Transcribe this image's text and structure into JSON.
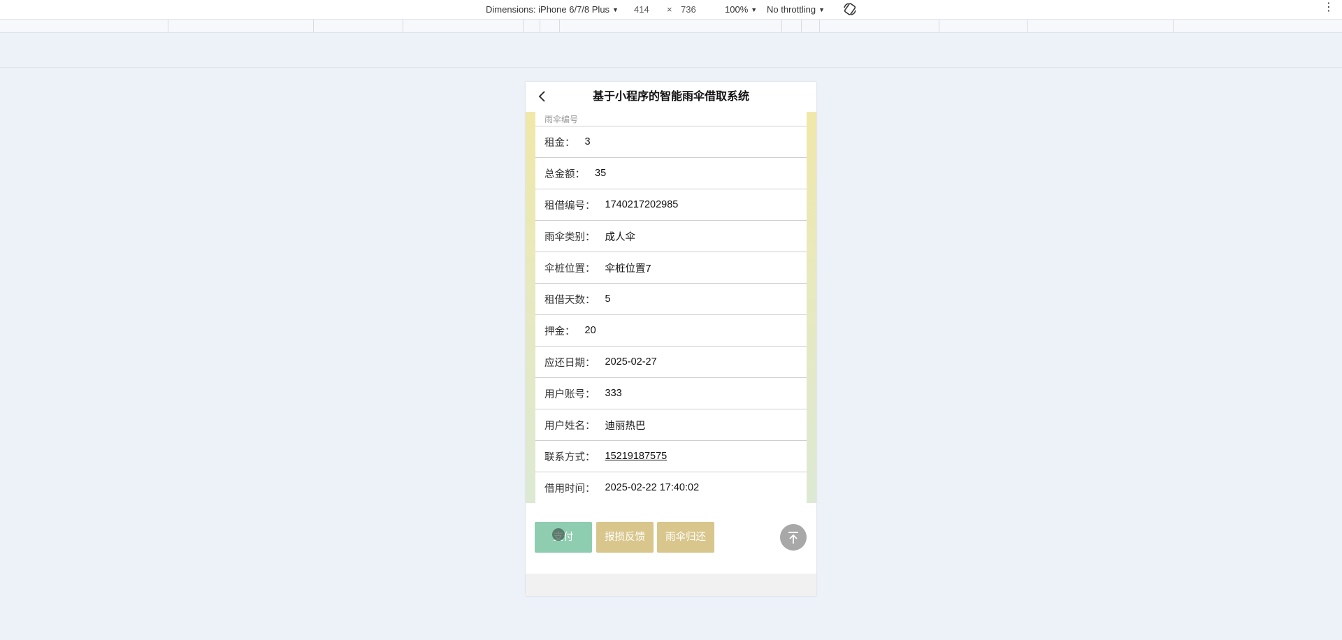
{
  "devtools": {
    "dimensions_label": "Dimensions: iPhone 6/7/8 Plus",
    "width": "414",
    "times": "×",
    "height": "736",
    "zoom": "100%",
    "throttling": "No throttling",
    "rotate_icon": "rotate-icon",
    "more_icon": "kebab-menu-icon"
  },
  "app": {
    "title": "基于小程序的智能雨伞借取系统",
    "back_icon": "back-arrow-icon"
  },
  "details": {
    "partial_label": "雨伞编号",
    "rows": [
      {
        "label": "租金：",
        "value": "3"
      },
      {
        "label": "总金额：",
        "value": "35"
      },
      {
        "label": "租借编号：",
        "value": "1740217202985"
      },
      {
        "label": "雨伞类别：",
        "value": "成人伞"
      },
      {
        "label": "伞桩位置：",
        "value": "伞桩位置7"
      },
      {
        "label": "租借天数：",
        "value": "5"
      },
      {
        "label": "押金：",
        "value": "20"
      },
      {
        "label": "应还日期：",
        "value": "2025-02-27"
      },
      {
        "label": "用户账号：",
        "value": "333"
      },
      {
        "label": "用户姓名：",
        "value": "迪丽热巴"
      },
      {
        "label": "联系方式：",
        "value": "15219187575"
      },
      {
        "label": "借用时间：",
        "value": "2025-02-22 17:40:02"
      }
    ]
  },
  "actions": {
    "pay": "支付",
    "report": "报损反馈",
    "return": "雨伞归还",
    "to_top_icon": "arrow-up-to-top-icon"
  },
  "colors": {
    "pay_button": "#8ecdb0",
    "secondary_button": "#d8c68c",
    "page_bg": "#edf1f8"
  }
}
